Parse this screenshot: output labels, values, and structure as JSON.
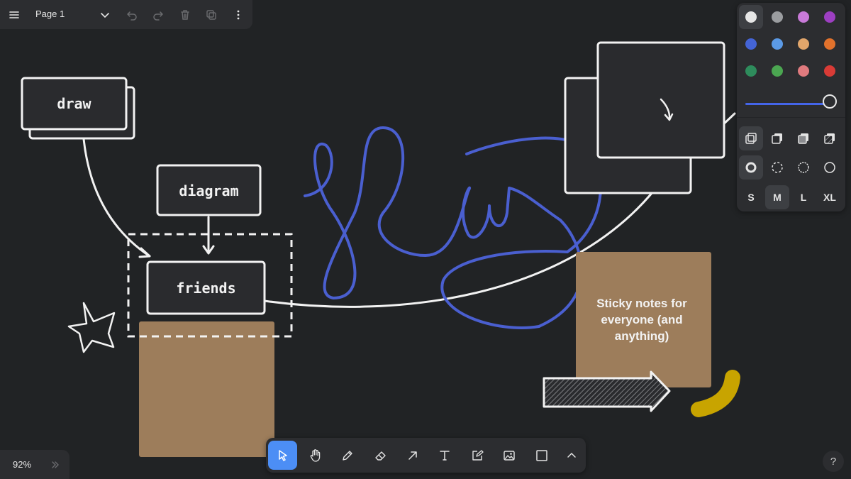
{
  "topbar": {
    "page_name": "Page 1",
    "icons": [
      "menu-icon",
      "chevron-down-icon",
      "undo-icon",
      "redo-icon",
      "trash-icon",
      "duplicate-icon",
      "more-vertical-icon"
    ]
  },
  "canvas": {
    "shapes": {
      "draw_label": "draw",
      "diagram_label": "diagram",
      "friends_label": "friends"
    },
    "sticky_note_text": "Sticky notes for everyone (and anything)",
    "colors": {
      "background": "#212325",
      "stroke": "#f2f2f2",
      "scribble_blue": "#4a5fd0",
      "sticky": "#9d7d5b",
      "yellow_stroke": "#c8a400"
    }
  },
  "style_panel": {
    "colors": [
      {
        "name": "white",
        "hex": "#e6e6e6",
        "selected": true
      },
      {
        "name": "grey",
        "hex": "#9b9da0"
      },
      {
        "name": "light-violet",
        "hex": "#c87ad8"
      },
      {
        "name": "violet",
        "hex": "#9d3fc2"
      },
      {
        "name": "blue",
        "hex": "#4464d6"
      },
      {
        "name": "light-blue",
        "hex": "#5b9ae6"
      },
      {
        "name": "yellow",
        "hex": "#e2a66b"
      },
      {
        "name": "orange",
        "hex": "#e2722c"
      },
      {
        "name": "green",
        "hex": "#2e8c5c"
      },
      {
        "name": "light-green",
        "hex": "#4ba651"
      },
      {
        "name": "light-red",
        "hex": "#e07a7e"
      },
      {
        "name": "red",
        "hex": "#d93b36"
      }
    ],
    "opacity_slider_value": 1,
    "fill_options": [
      "fill-none-icon",
      "fill-semi-icon",
      "fill-solid-icon",
      "fill-pattern-icon"
    ],
    "dash_options": [
      "dash-draw-icon",
      "dash-dashed-icon",
      "dash-dotted-icon",
      "dash-solid-icon"
    ],
    "sizes": [
      "S",
      "M",
      "L",
      "XL"
    ],
    "selected_size": "M"
  },
  "toolbar": {
    "tools": [
      {
        "name": "select",
        "icon": "cursor-icon",
        "active": true
      },
      {
        "name": "hand",
        "icon": "hand-icon"
      },
      {
        "name": "draw",
        "icon": "pencil-icon"
      },
      {
        "name": "eraser",
        "icon": "eraser-icon"
      },
      {
        "name": "arrow",
        "icon": "arrow-icon"
      },
      {
        "name": "text",
        "icon": "text-icon"
      },
      {
        "name": "note",
        "icon": "note-icon"
      },
      {
        "name": "asset",
        "icon": "image-icon"
      },
      {
        "name": "rectangle",
        "icon": "rectangle-icon"
      },
      {
        "name": "more",
        "icon": "chevron-up-icon"
      }
    ]
  },
  "zoom": {
    "level": "92%"
  },
  "help": {
    "label": "?"
  }
}
